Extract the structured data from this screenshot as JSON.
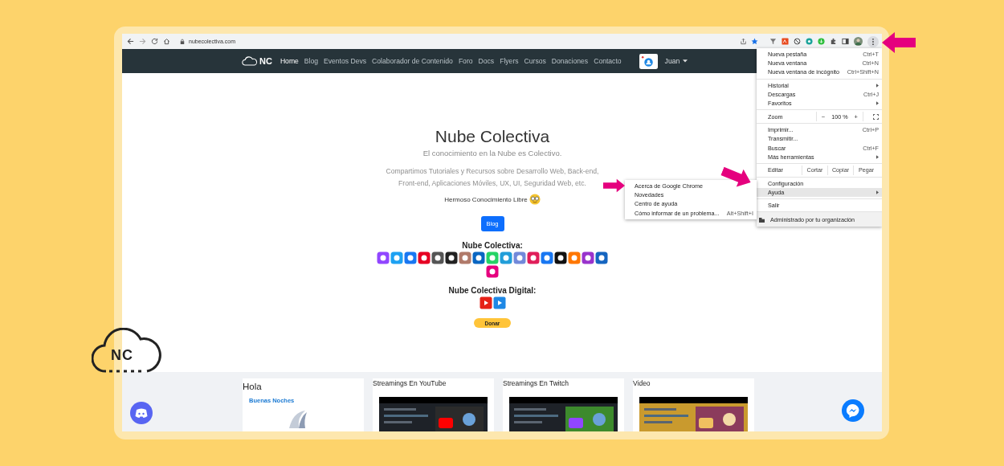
{
  "browser": {
    "url": "nubecolectiva.com"
  },
  "navbar": {
    "logo": "NC",
    "links": [
      {
        "label": "Home",
        "selected": true
      },
      {
        "label": "Blog",
        "selected": false
      },
      {
        "label": "Eventos Devs",
        "selected": false
      },
      {
        "label": "Colaborador de Contenido",
        "selected": false
      },
      {
        "label": "Foro",
        "selected": false
      },
      {
        "label": "Docs",
        "selected": false
      },
      {
        "label": "Flyers",
        "selected": false
      },
      {
        "label": "Cursos",
        "selected": false
      },
      {
        "label": "Donaciones",
        "selected": false
      },
      {
        "label": "Contacto",
        "selected": false
      }
    ],
    "user": "Juan"
  },
  "hero": {
    "title": "Nube Colectiva",
    "subtitle": "El conocimiento en la Nube es Colectivo.",
    "description": "Compartimos Tutoriales y Recursos sobre Desarrollo Web, Back-end, Front-end, Aplicaciones Móviles, UX, UI, Seguridad Web, etc.",
    "tagline": "Hermoso Conocimiento Libre",
    "button": "Blog"
  },
  "social": {
    "title": "Nube Colectiva:",
    "icons": [
      {
        "color": "#9146ff"
      },
      {
        "color": "#1da1f2"
      },
      {
        "color": "#1877f2"
      },
      {
        "color": "#e60023"
      },
      {
        "color": "#555555"
      },
      {
        "color": "#222222"
      },
      {
        "color": "#b07a6a"
      },
      {
        "color": "#0a66c2"
      },
      {
        "color": "#25d366"
      },
      {
        "color": "#229ed9"
      },
      {
        "color": "#7289da"
      },
      {
        "color": "#e01e5a"
      },
      {
        "color": "#1877f2"
      },
      {
        "color": "#111111"
      },
      {
        "color": "#ff7700"
      },
      {
        "color": "#9933cc"
      },
      {
        "color": "#1565c0"
      },
      {
        "color": "#e6007e"
      }
    ]
  },
  "digital": {
    "title": "Nube Colectiva Digital:",
    "icons": [
      {
        "color": "#e62117"
      },
      {
        "color": "#1e88e5"
      }
    ]
  },
  "donate_button": "Donar",
  "cards": [
    {
      "kind": "greeting",
      "title": "Hola",
      "subtitle": "Buenas Noches"
    },
    {
      "kind": "video",
      "title": "Streamings En YouTube"
    },
    {
      "kind": "video",
      "title": "Streamings En Twitch"
    },
    {
      "kind": "video",
      "title": "Video"
    }
  ],
  "chrome_menu": {
    "sections": [
      {
        "items": [
          {
            "kind": "item",
            "label": "Nueva pestaña",
            "shortcut": "Ctrl+T",
            "has_submenu": false,
            "selected": false
          },
          {
            "kind": "item",
            "label": "Nueva ventana",
            "shortcut": "Ctrl+N",
            "has_submenu": false,
            "selected": false
          },
          {
            "kind": "item",
            "label": "Nueva ventana de incógnito",
            "shortcut": "Ctrl+Shift+N",
            "has_submenu": false,
            "selected": false
          }
        ]
      },
      {
        "items": [
          {
            "kind": "item",
            "label": "Historial",
            "has_submenu": true,
            "selected": false
          },
          {
            "kind": "item",
            "label": "Descargas",
            "shortcut": "Ctrl+J",
            "has_submenu": false,
            "selected": false
          },
          {
            "kind": "item",
            "label": "Favoritos",
            "has_submenu": true,
            "selected": false
          }
        ]
      },
      {
        "items": [
          {
            "kind": "zoom",
            "label": "Zoom",
            "minus": "−",
            "value": "100 %",
            "plus": "+"
          }
        ]
      },
      {
        "items": [
          {
            "kind": "item",
            "label": "Imprimir...",
            "shortcut": "Ctrl+P",
            "has_submenu": false,
            "selected": false
          },
          {
            "kind": "item",
            "label": "Transmitir...",
            "has_submenu": false,
            "selected": false
          },
          {
            "kind": "item",
            "label": "Buscar",
            "shortcut": "Ctrl+F",
            "has_submenu": false,
            "selected": false
          },
          {
            "kind": "item",
            "label": "Más herramientas",
            "has_submenu": true,
            "selected": false
          }
        ]
      },
      {
        "items": [
          {
            "kind": "edit",
            "label": "Editar",
            "actions": [
              "Cortar",
              "Copiar",
              "Pegar"
            ]
          }
        ]
      },
      {
        "items": [
          {
            "kind": "item",
            "label": "Configuración",
            "has_submenu": false,
            "selected": false
          },
          {
            "kind": "item",
            "label": "Ayuda",
            "has_submenu": true,
            "selected": true
          }
        ]
      },
      {
        "items": [
          {
            "kind": "item",
            "label": "Salir",
            "has_submenu": false,
            "selected": false
          }
        ]
      },
      {
        "items": [
          {
            "kind": "managed",
            "label": "Administrado por tu organización"
          }
        ]
      }
    ]
  },
  "help_submenu": [
    {
      "label": "Acerca de Google Chrome",
      "selected": false
    },
    {
      "label": "Novedades",
      "selected": false
    },
    {
      "label": "Centro de ayuda",
      "selected": false
    },
    {
      "label": "Cómo informar de un problema...",
      "shortcut": "Alt+Shift+I",
      "selected": false
    }
  ],
  "overlay_logo": "NC"
}
